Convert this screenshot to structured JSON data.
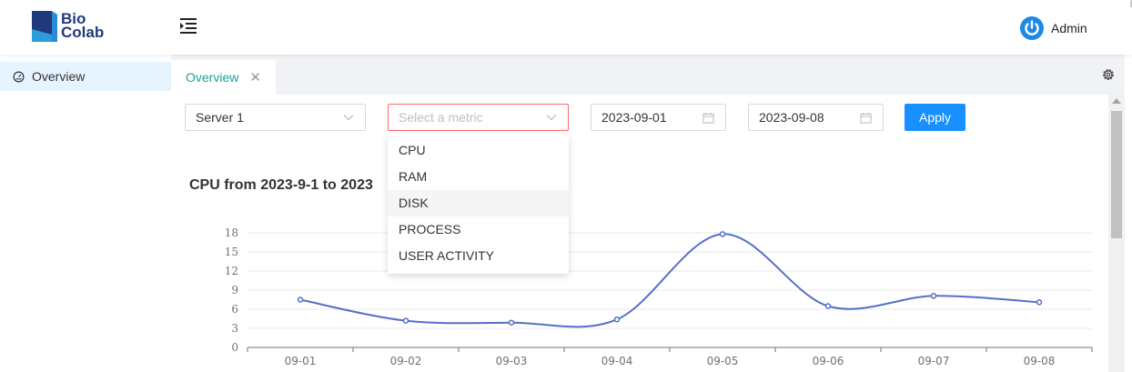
{
  "brand": {
    "line1": "Bio",
    "line2": "Colab"
  },
  "user": {
    "name": "Admin"
  },
  "sidebar": {
    "items": [
      {
        "label": "Overview"
      }
    ]
  },
  "tabs": [
    {
      "label": "Overview",
      "close": "✕"
    }
  ],
  "filters": {
    "server": "Server 1",
    "metric_placeholder": "Select a metric",
    "start_date": "2023-09-01",
    "end_date": "2023-09-08",
    "apply_label": "Apply"
  },
  "metric_options": [
    "CPU",
    "RAM",
    "DISK",
    "PROCESS",
    "USER ACTIVITY"
  ],
  "chart_data": {
    "type": "line",
    "title": "CPU from 2023-9-1 to 2023",
    "categories": [
      "09-01",
      "09-02",
      "09-03",
      "09-04",
      "09-05",
      "09-06",
      "09-07",
      "09-08"
    ],
    "values": [
      7.5,
      4.2,
      3.9,
      4.4,
      17.8,
      6.5,
      8.1,
      7.1
    ],
    "yticks": [
      0,
      3,
      6,
      9,
      12,
      15,
      18
    ],
    "ylim": [
      0,
      18
    ],
    "line_color": "#5470c6",
    "grid": true
  }
}
